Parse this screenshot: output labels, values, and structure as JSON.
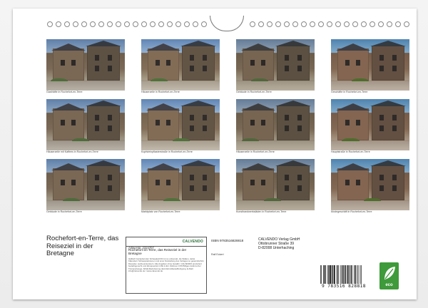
{
  "cover": {
    "title": "Rochefort-en-Terre, das Reiseziel in der Bretagne"
  },
  "photos": [
    {
      "caption": "Gasthäfte in Rochefort-en-Terre"
    },
    {
      "caption": "Häuserzeile in Rochefort-en-Terre"
    },
    {
      "caption": "Gebäude in Rochefort-en-Terre"
    },
    {
      "caption": "Geschäfte in Rochefort-en-Terre"
    },
    {
      "caption": "Häuserzeile mit Kaffees in Rochefort-en-Terre"
    },
    {
      "caption": "Kopfsteinpflasterstraße in Rochefort-en-Terre"
    },
    {
      "caption": "Häuserzeile in Rochefort-en-Terre"
    },
    {
      "caption": "Hauptstraße in Rochefort-en-Terre"
    },
    {
      "caption": "Gebäude in Rochefort-en-Terre"
    },
    {
      "caption": "Marktplatz von Rochefort-en-Terre"
    },
    {
      "caption": "Kunsthandwerksläden in Rochefort-en-Terre"
    },
    {
      "caption": "Modegeschäft in Rochefort-en-Terre"
    }
  ],
  "infobox": {
    "article_no": "Artikel-Nr. 2324707",
    "logo": "CALVENDO",
    "subtitle": "Rochefort-en-Terre, das Reiseziel in der Bretagne",
    "small_print": "Idyllisch bezaubernder Schauplatz/Ort ist so unbemalt, die Stätten, derlei Kalendern Schauspielszenen und einer Darstellung des Verlages so gesamt/schön Diesoder, werbeunsterstern. Alle Angaben ohne Gewähr. CALVENDO produziert bedarfsgerecht und klimaneutral in DE & EU. Rahmen 0,56 Billigen dank kurzer Transportwege. Abfall-Reduzierung dank Einzelbestellfertigung. E-Mail: info@calvendo.de / www.calvendo.de"
  },
  "isbn": "ISBN 9783516828818",
  "author": "Ralf Eckert",
  "publisher": {
    "name": "CALVENDO Verlag GmbH",
    "street": "Ottobrunner Straße 39",
    "city": "D-82008 Unterhaching"
  },
  "barcode": {
    "digits": "9 783516 828818",
    "pattern": "10100011011000101011110101011100011010001001101010110011011001101000101100101000101"
  },
  "eco_badge": {
    "label": "eco",
    "color": "#3e9a3a"
  },
  "colors": {
    "caption": "#444444",
    "text": "#222222"
  }
}
